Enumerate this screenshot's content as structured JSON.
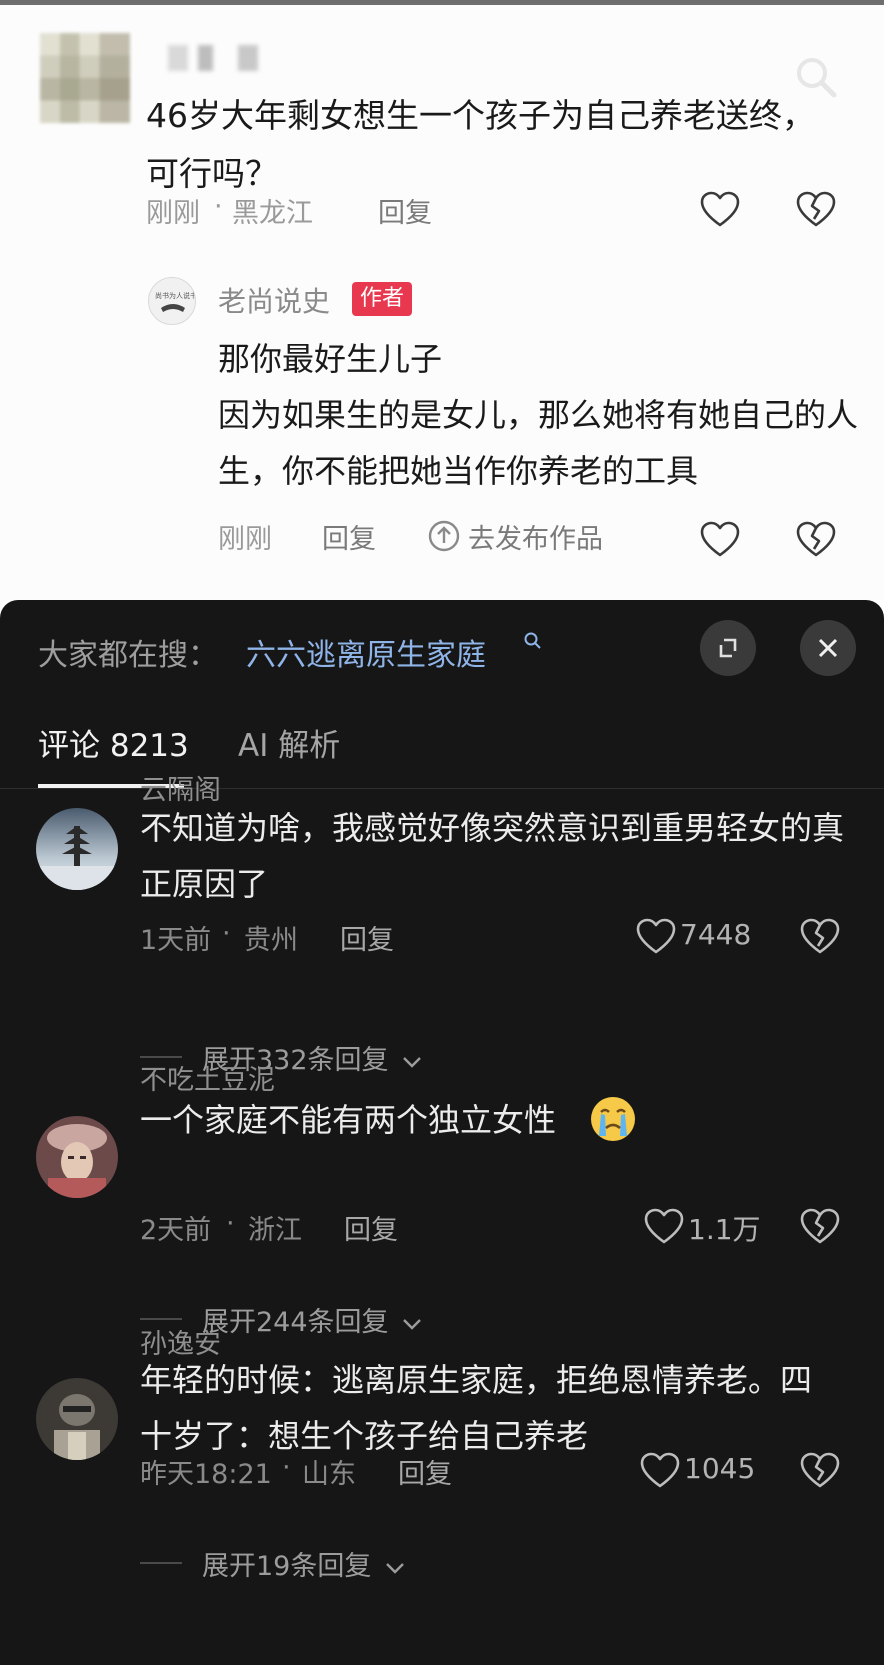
{
  "original_post": {
    "question": "46岁大年剩女想生一个孩子为自己养老送终，可行吗？",
    "time": "刚刚",
    "location": "黑龙江",
    "reply_label": "回复"
  },
  "author_reply": {
    "name": "老尚说史",
    "badge": "作者",
    "lines": [
      "那你最好生儿子",
      "因为如果生的是女儿，那么她将有她自己的人生，你不能把她当作你养老的工具"
    ],
    "time": "刚刚",
    "reply_label": "回复",
    "publish_label": "去发布作品"
  },
  "panel": {
    "hot_search_prefix": "大家都在搜：",
    "hot_search_term": "六六逃离原生家庭",
    "tabs": [
      {
        "label": "评论 8213",
        "active": true
      },
      {
        "label": "AI 解析",
        "active": false
      }
    ]
  },
  "comments": [
    {
      "name": "云隔阁",
      "text": "不知道为啥，我感觉好像突然意识到重男轻女的真正原因了",
      "time": "1天前",
      "location": "贵州",
      "reply_label": "回复",
      "likes": "7448",
      "expand": "展开332条回复"
    },
    {
      "name": "不吃土豆泥",
      "text": "一个家庭不能有两个独立女性",
      "time": "2天前",
      "location": "浙江",
      "reply_label": "回复",
      "likes": "1.1万",
      "expand": "展开244条回复"
    },
    {
      "name": "孙逸安",
      "text": "年轻的时候：逃离原生家庭，拒绝恩情养老。四十岁了：想生个孩子给自己养老",
      "time": "昨天18:21",
      "location": "山东",
      "reply_label": "回复",
      "likes": "1045",
      "expand": "展开19条回复"
    }
  ],
  "colors": {
    "dark_bg": "#161616",
    "link_blue": "#8fb4e8",
    "author_badge": "#e8384f"
  },
  "icons": [
    "search-icon",
    "heart-icon",
    "broken-heart-icon",
    "publish-icon",
    "expand-icon",
    "close-icon",
    "chevron-down-icon",
    "crying-emoji-icon"
  ]
}
